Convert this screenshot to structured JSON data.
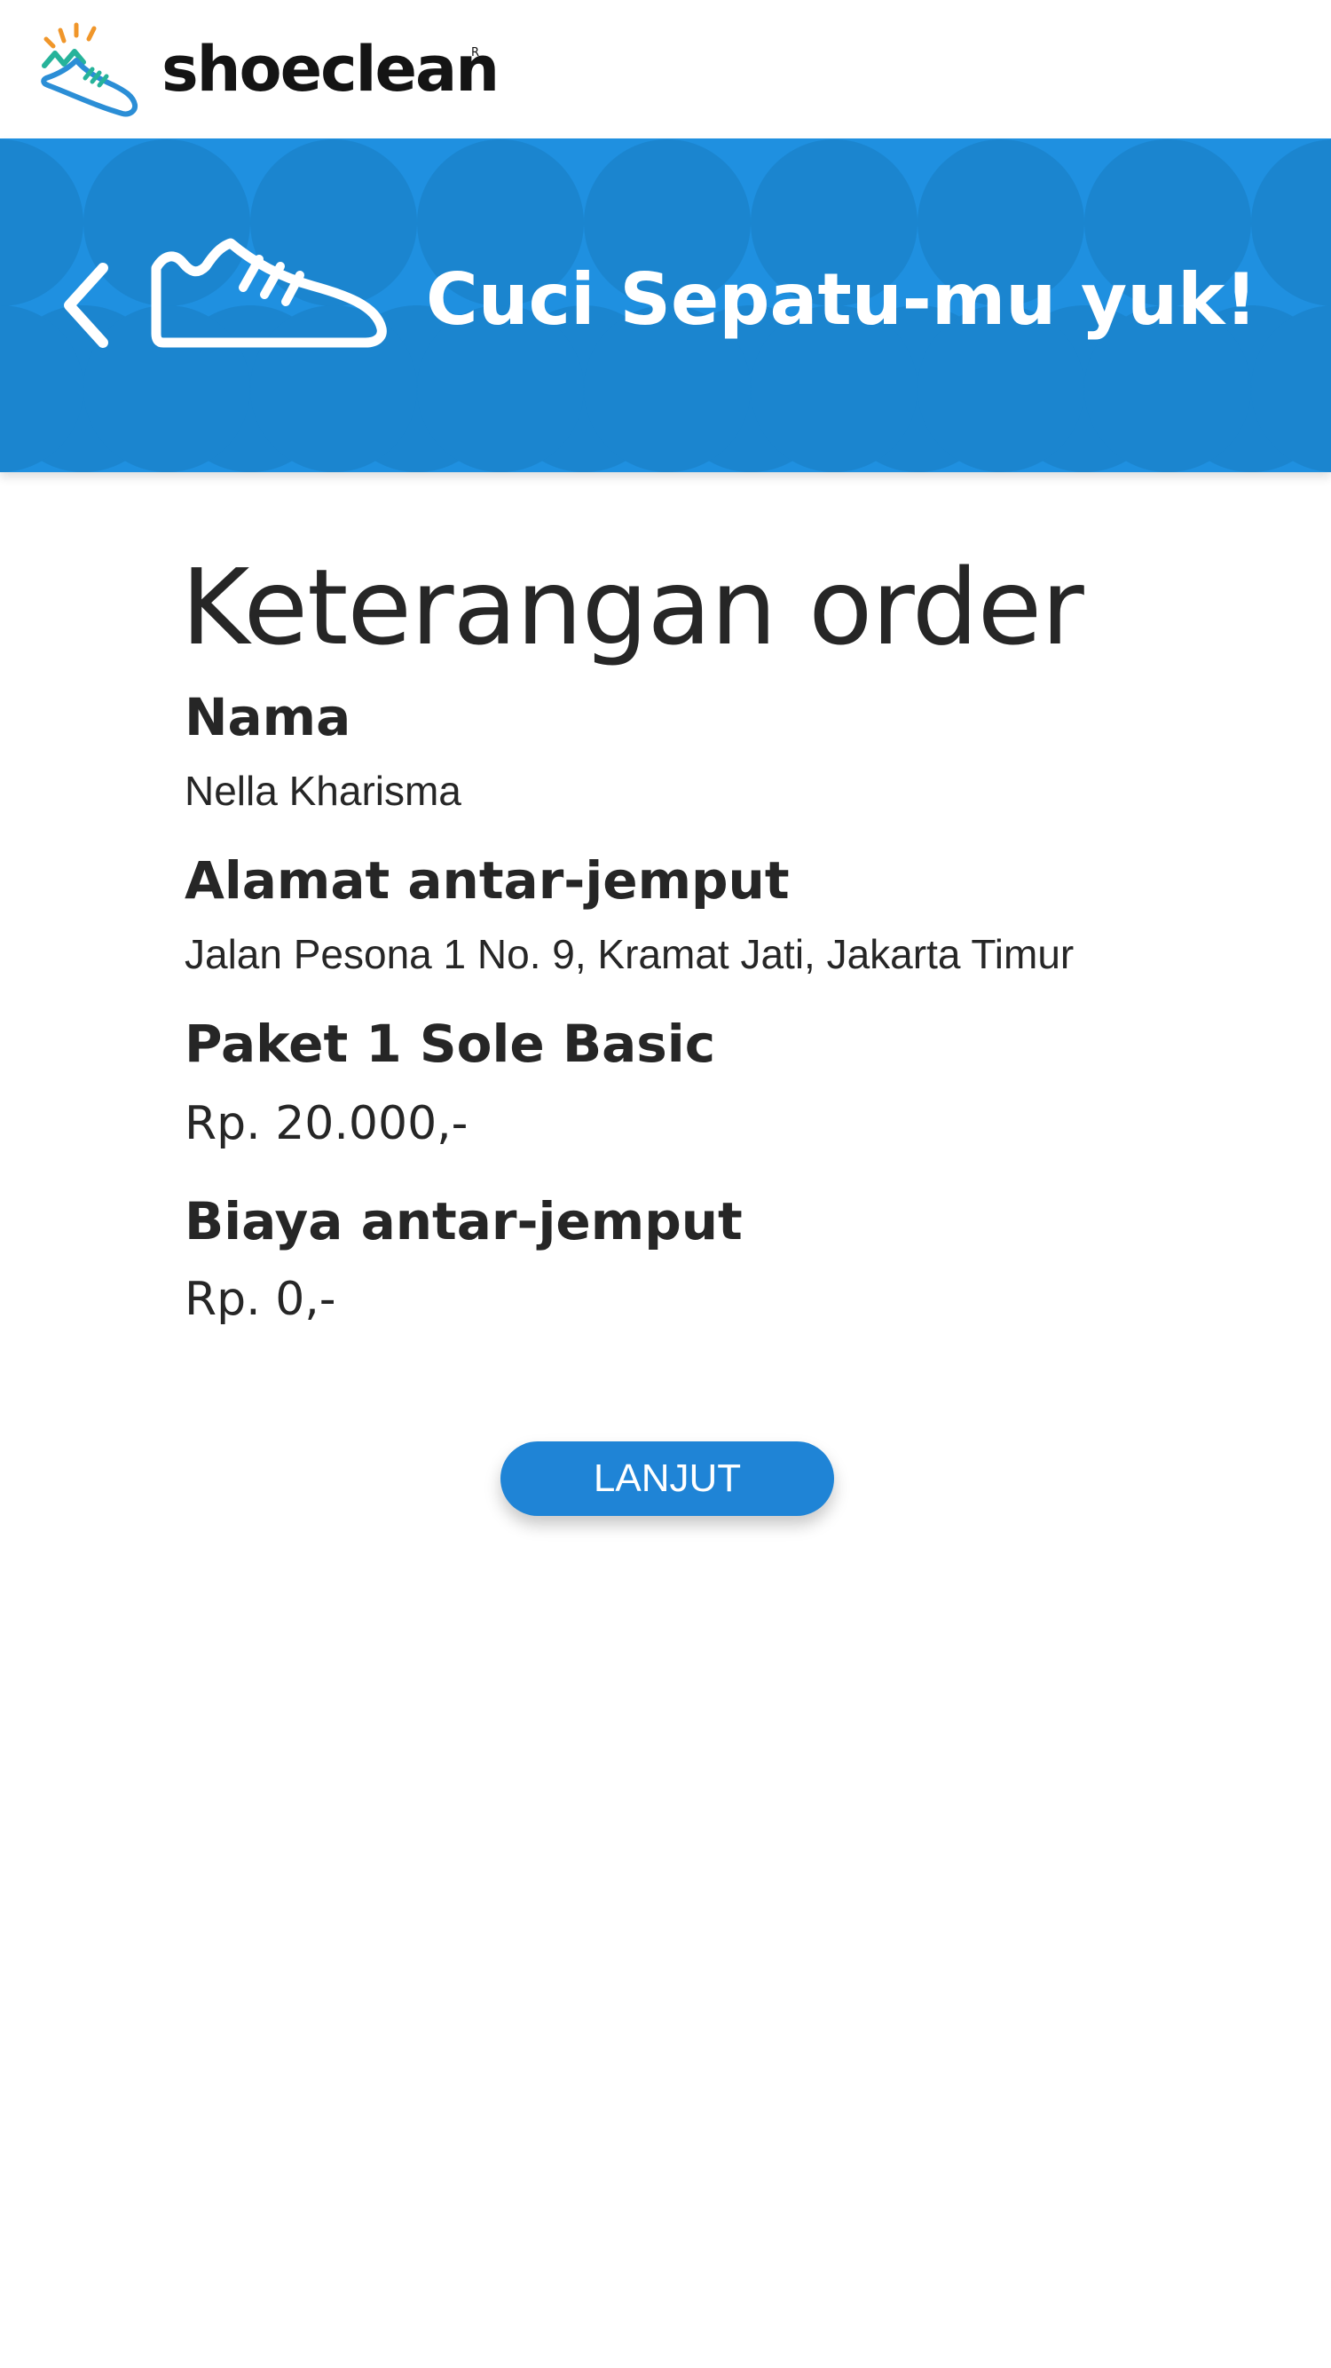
{
  "app": {
    "logo_text": "shoeclean",
    "logo_registered": "R",
    "logo_icon": "shoe-logo-icon"
  },
  "banner": {
    "title": "Cuci Sepatu-mu yuk!",
    "back_icon": "chevron-left-icon",
    "shoe_icon": "sneaker-icon",
    "background_color": "#1f90e0"
  },
  "order": {
    "title": "Keterangan order",
    "fields": [
      {
        "label": "Nama",
        "value": "Nella Kharisma"
      },
      {
        "label": "Alamat antar-jemput",
        "value": "Jalan Pesona 1 No. 9, Kramat Jati, Jakarta Timur"
      },
      {
        "label": "Paket 1 Sole Basic",
        "value": "Rp. 20.000,-"
      },
      {
        "label": "Biaya antar-jemput",
        "value": "Rp. 0,-"
      }
    ]
  },
  "actions": {
    "next_label": "LANJUT",
    "accent_color": "#1f84d6"
  }
}
